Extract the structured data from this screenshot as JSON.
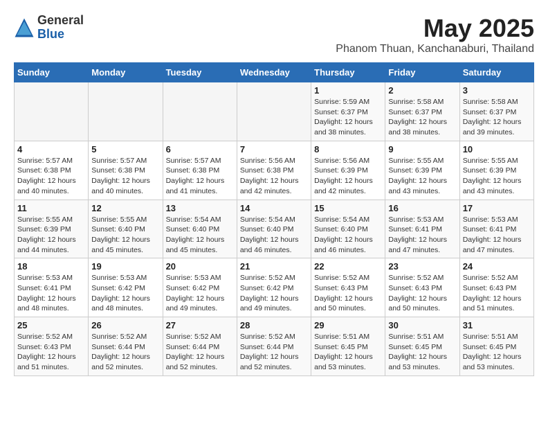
{
  "header": {
    "logo_general": "General",
    "logo_blue": "Blue",
    "month_year": "May 2025",
    "location": "Phanom Thuan, Kanchanaburi, Thailand"
  },
  "days_of_week": [
    "Sunday",
    "Monday",
    "Tuesday",
    "Wednesday",
    "Thursday",
    "Friday",
    "Saturday"
  ],
  "weeks": [
    [
      {
        "day": "",
        "info": ""
      },
      {
        "day": "",
        "info": ""
      },
      {
        "day": "",
        "info": ""
      },
      {
        "day": "",
        "info": ""
      },
      {
        "day": "1",
        "info": "Sunrise: 5:59 AM\nSunset: 6:37 PM\nDaylight: 12 hours\nand 38 minutes."
      },
      {
        "day": "2",
        "info": "Sunrise: 5:58 AM\nSunset: 6:37 PM\nDaylight: 12 hours\nand 38 minutes."
      },
      {
        "day": "3",
        "info": "Sunrise: 5:58 AM\nSunset: 6:37 PM\nDaylight: 12 hours\nand 39 minutes."
      }
    ],
    [
      {
        "day": "4",
        "info": "Sunrise: 5:57 AM\nSunset: 6:38 PM\nDaylight: 12 hours\nand 40 minutes."
      },
      {
        "day": "5",
        "info": "Sunrise: 5:57 AM\nSunset: 6:38 PM\nDaylight: 12 hours\nand 40 minutes."
      },
      {
        "day": "6",
        "info": "Sunrise: 5:57 AM\nSunset: 6:38 PM\nDaylight: 12 hours\nand 41 minutes."
      },
      {
        "day": "7",
        "info": "Sunrise: 5:56 AM\nSunset: 6:38 PM\nDaylight: 12 hours\nand 42 minutes."
      },
      {
        "day": "8",
        "info": "Sunrise: 5:56 AM\nSunset: 6:39 PM\nDaylight: 12 hours\nand 42 minutes."
      },
      {
        "day": "9",
        "info": "Sunrise: 5:55 AM\nSunset: 6:39 PM\nDaylight: 12 hours\nand 43 minutes."
      },
      {
        "day": "10",
        "info": "Sunrise: 5:55 AM\nSunset: 6:39 PM\nDaylight: 12 hours\nand 43 minutes."
      }
    ],
    [
      {
        "day": "11",
        "info": "Sunrise: 5:55 AM\nSunset: 6:39 PM\nDaylight: 12 hours\nand 44 minutes."
      },
      {
        "day": "12",
        "info": "Sunrise: 5:55 AM\nSunset: 6:40 PM\nDaylight: 12 hours\nand 45 minutes."
      },
      {
        "day": "13",
        "info": "Sunrise: 5:54 AM\nSunset: 6:40 PM\nDaylight: 12 hours\nand 45 minutes."
      },
      {
        "day": "14",
        "info": "Sunrise: 5:54 AM\nSunset: 6:40 PM\nDaylight: 12 hours\nand 46 minutes."
      },
      {
        "day": "15",
        "info": "Sunrise: 5:54 AM\nSunset: 6:40 PM\nDaylight: 12 hours\nand 46 minutes."
      },
      {
        "day": "16",
        "info": "Sunrise: 5:53 AM\nSunset: 6:41 PM\nDaylight: 12 hours\nand 47 minutes."
      },
      {
        "day": "17",
        "info": "Sunrise: 5:53 AM\nSunset: 6:41 PM\nDaylight: 12 hours\nand 47 minutes."
      }
    ],
    [
      {
        "day": "18",
        "info": "Sunrise: 5:53 AM\nSunset: 6:41 PM\nDaylight: 12 hours\nand 48 minutes."
      },
      {
        "day": "19",
        "info": "Sunrise: 5:53 AM\nSunset: 6:42 PM\nDaylight: 12 hours\nand 48 minutes."
      },
      {
        "day": "20",
        "info": "Sunrise: 5:53 AM\nSunset: 6:42 PM\nDaylight: 12 hours\nand 49 minutes."
      },
      {
        "day": "21",
        "info": "Sunrise: 5:52 AM\nSunset: 6:42 PM\nDaylight: 12 hours\nand 49 minutes."
      },
      {
        "day": "22",
        "info": "Sunrise: 5:52 AM\nSunset: 6:43 PM\nDaylight: 12 hours\nand 50 minutes."
      },
      {
        "day": "23",
        "info": "Sunrise: 5:52 AM\nSunset: 6:43 PM\nDaylight: 12 hours\nand 50 minutes."
      },
      {
        "day": "24",
        "info": "Sunrise: 5:52 AM\nSunset: 6:43 PM\nDaylight: 12 hours\nand 51 minutes."
      }
    ],
    [
      {
        "day": "25",
        "info": "Sunrise: 5:52 AM\nSunset: 6:43 PM\nDaylight: 12 hours\nand 51 minutes."
      },
      {
        "day": "26",
        "info": "Sunrise: 5:52 AM\nSunset: 6:44 PM\nDaylight: 12 hours\nand 52 minutes."
      },
      {
        "day": "27",
        "info": "Sunrise: 5:52 AM\nSunset: 6:44 PM\nDaylight: 12 hours\nand 52 minutes."
      },
      {
        "day": "28",
        "info": "Sunrise: 5:52 AM\nSunset: 6:44 PM\nDaylight: 12 hours\nand 52 minutes."
      },
      {
        "day": "29",
        "info": "Sunrise: 5:51 AM\nSunset: 6:45 PM\nDaylight: 12 hours\nand 53 minutes."
      },
      {
        "day": "30",
        "info": "Sunrise: 5:51 AM\nSunset: 6:45 PM\nDaylight: 12 hours\nand 53 minutes."
      },
      {
        "day": "31",
        "info": "Sunrise: 5:51 AM\nSunset: 6:45 PM\nDaylight: 12 hours\nand 53 minutes."
      }
    ]
  ]
}
